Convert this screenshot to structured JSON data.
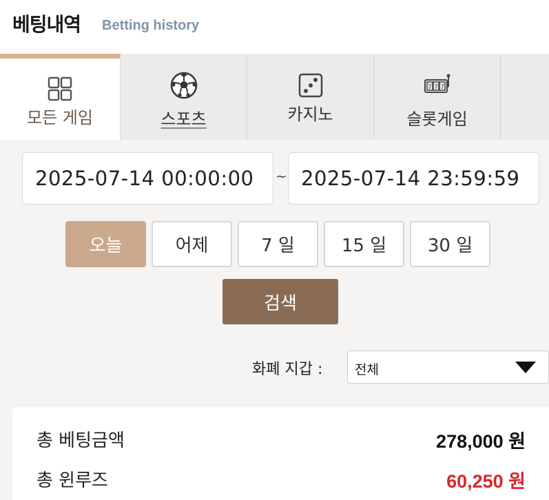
{
  "header": {
    "title": "베팅내역",
    "subtitle": "Betting history"
  },
  "tabs": [
    {
      "label": "모든 게임",
      "icon": "grid-icon",
      "active": true
    },
    {
      "label": "스포츠",
      "icon": "soccer-ball-icon",
      "active": false
    },
    {
      "label": "카지노",
      "icon": "dice-icon",
      "active": false
    },
    {
      "label": "슬롯게임",
      "icon": "slot-machine-icon",
      "active": false
    }
  ],
  "date_range": {
    "start": "2025-07-14 00:00:00",
    "separator": "~",
    "end": "2025-07-14 23:59:59"
  },
  "periods": [
    {
      "label": "오늘",
      "active": true
    },
    {
      "label": "어제",
      "active": false
    },
    {
      "label": "7 일",
      "active": false
    },
    {
      "label": "15 일",
      "active": false
    },
    {
      "label": "30 일",
      "active": false
    }
  ],
  "search_label": "검색",
  "wallet": {
    "label": "화폐 지갑 :",
    "selected": "전체"
  },
  "summary": {
    "total_bet_label": "총 베팅금액",
    "total_bet_value": "278,000 원",
    "total_winloss_label": "총 윈루즈",
    "total_winloss_value": "60,250 원"
  },
  "colors": {
    "accent": "#d9b58f",
    "active_period": "#caa98d",
    "search_button": "#8a6c55",
    "negative": "#d8262c"
  }
}
